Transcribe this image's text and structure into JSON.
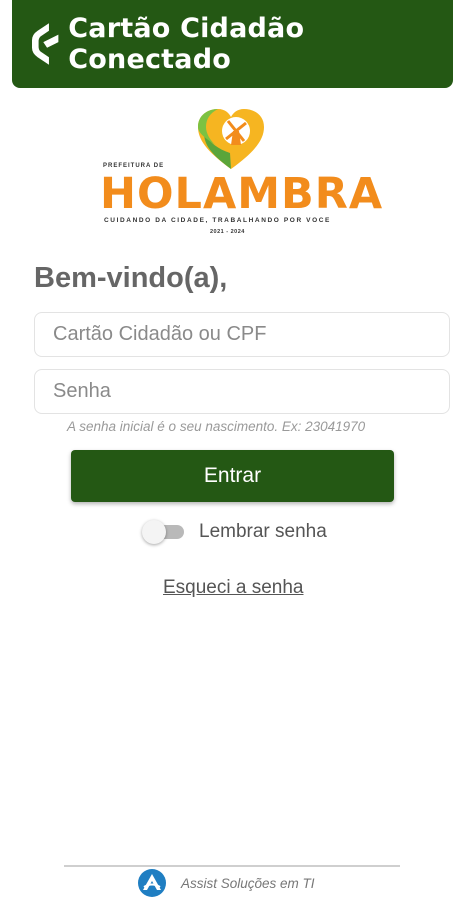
{
  "header": {
    "title": "Cartão Cidadão Conectado",
    "background": "#245814"
  },
  "brand": {
    "prefeitura": "PREFEITURA DE",
    "city": "HOLAMBRA",
    "tagline": "CUIDANDO DA CIDADE, TRABALHANDO POR VOCE",
    "years": "2021 - 2024",
    "city_color": "#f28c1c"
  },
  "login": {
    "welcome": "Bem-vindo(a),",
    "cpf_placeholder": "Cartão Cidadão ou CPF",
    "password_placeholder": "Senha",
    "hint": "A senha inicial é o seu nascimento. Ex: 23041970",
    "submit_label": "Entrar",
    "remember_label": "Lembrar senha",
    "remember_checked": false,
    "forgot_label": "Esqueci a senha"
  },
  "footer": {
    "text": "Assist Soluções em TI"
  }
}
